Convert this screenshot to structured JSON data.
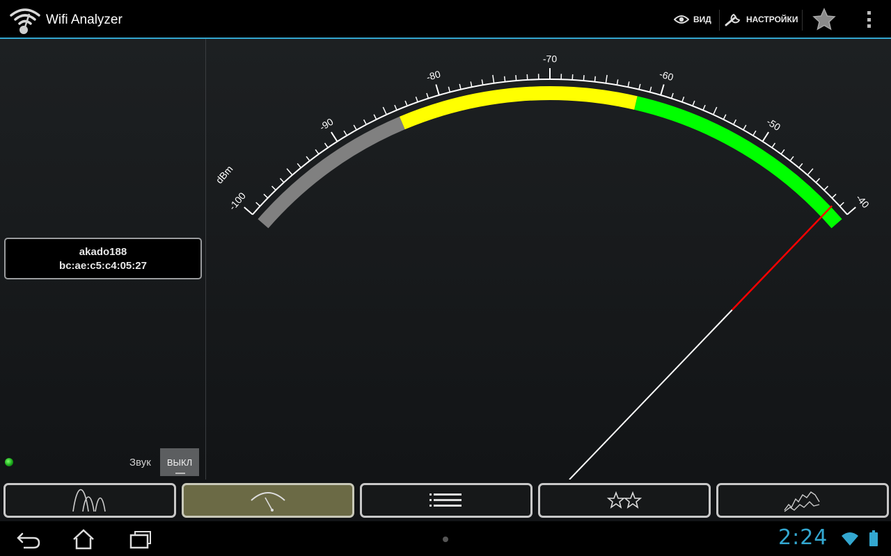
{
  "app": {
    "title": "Wifi Analyzer"
  },
  "action_bar": {
    "view_label": "ВИД",
    "settings_label": "НАСТРОЙКИ"
  },
  "access_point": {
    "ssid": "akado188",
    "bssid": "bc:ae:c5:c4:05:27"
  },
  "sound": {
    "label": "Звук",
    "toggle_label": "ВЫКЛ"
  },
  "meter": {
    "unit": "dBm",
    "min": -100,
    "max": -40,
    "tick_labels": [
      "-100",
      "-90",
      "-80",
      "-70",
      "-60",
      "-50",
      "-40"
    ],
    "zones": [
      {
        "from": -100,
        "to": -84,
        "color": "#808080"
      },
      {
        "from": -84,
        "to": -62,
        "color": "#ffff00"
      },
      {
        "from": -62,
        "to": -40,
        "color": "#00ff00"
      }
    ],
    "needle_value": -41.5,
    "needle_color": "#ffffff",
    "needle_tip_color": "#ff0000"
  },
  "tabs": [
    {
      "icon": "channel-graph-icon",
      "active": false
    },
    {
      "icon": "signal-meter-icon",
      "active": true
    },
    {
      "icon": "ap-list-icon",
      "active": false
    },
    {
      "icon": "channel-rating-icon",
      "active": false
    },
    {
      "icon": "time-graph-icon",
      "active": false
    }
  ],
  "status_bar": {
    "time": "2:24"
  },
  "colors": {
    "accent": "#33a7d0",
    "active_tab": "#6b6a45"
  }
}
